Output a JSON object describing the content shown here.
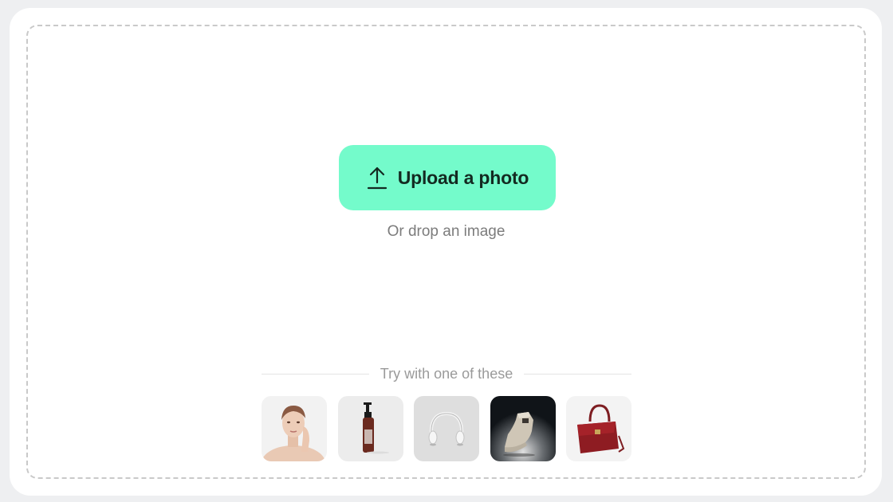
{
  "upload": {
    "button_label": "Upload a photo",
    "button_icon": "upload-icon",
    "hint": "Or drop an image",
    "accent_color": "#74fbcb"
  },
  "samples": {
    "title": "Try with one of these",
    "items": [
      {
        "label": "woman-portrait",
        "icon": "portrait-thumbnail"
      },
      {
        "label": "pump-bottle",
        "icon": "bottle-thumbnail"
      },
      {
        "label": "headphones",
        "icon": "headphones-thumbnail"
      },
      {
        "label": "sneaker",
        "icon": "sneaker-thumbnail"
      },
      {
        "label": "handbag",
        "icon": "handbag-thumbnail"
      }
    ]
  }
}
